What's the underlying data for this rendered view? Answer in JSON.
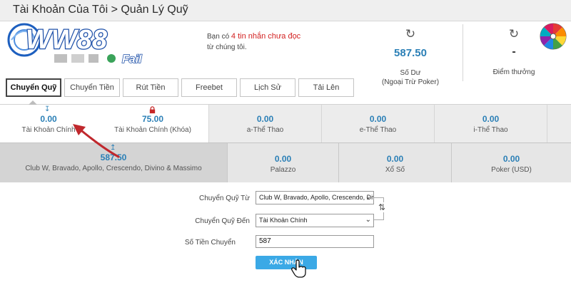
{
  "breadcrumb": "Tài Khoản Của Tôi > Quản Lý Quỹ",
  "logo": {
    "text": "WW88",
    "suffix": "Fail"
  },
  "message": {
    "prefix": "Bạn có",
    "highlight": "4 tin nhắn chưa đọc",
    "suffix": "từ chúng tôi."
  },
  "balance": {
    "value": "587.50",
    "label": "Số Dư",
    "note": "(Ngoại Trừ Poker)"
  },
  "points": {
    "value": "-",
    "label": "Điểm thưởng"
  },
  "icons": {
    "refresh": "refresh-icon",
    "wheel": "lucky-wheel-icon",
    "lock": "lock-icon",
    "arrow": "down-arrow-icon",
    "cursor": "hand-cursor-icon"
  },
  "tabs": [
    {
      "label": "Chuyển Quỹ",
      "active": true
    },
    {
      "label": "Chuyển Tiền"
    },
    {
      "label": "Rút Tiền"
    },
    {
      "label": "Freebet"
    },
    {
      "label": "Lịch Sử"
    },
    {
      "label": "Tải Lên"
    }
  ],
  "wallets_row1": [
    {
      "value": "0.00",
      "label": "Tài Khoản Chính"
    },
    {
      "value": "75.00",
      "label": "Tài Khoản Chính (Khóa)"
    },
    {
      "value": "0.00",
      "label": "a-Thể Thao"
    },
    {
      "value": "0.00",
      "label": "e-Thể Thao"
    },
    {
      "value": "0.00",
      "label": "i-Thể Thao"
    }
  ],
  "wallets_row2": [
    {
      "value": "587.50",
      "label": "Club W, Bravado, Apollo, Crescendo, Divino & Massimo"
    },
    {
      "value": "0.00",
      "label": "Palazzo"
    },
    {
      "value": "0.00",
      "label": "Xổ Số"
    },
    {
      "value": "0.00",
      "label": "Poker (USD)"
    }
  ],
  "form": {
    "from_label": "Chuyển Quỹ Từ",
    "from_value": "Club W, Bravado, Apollo, Crescendo, Divino & Massimo",
    "to_label": "Chuyển Quỹ Đến",
    "to_value": "Tài Khoản Chính",
    "amount_label": "Số Tiền Chuyển",
    "amount_value": "587",
    "submit_label": "XÁC NHẬN"
  },
  "colors": {
    "accent": "#2a7fb6",
    "button": "#3ba9e6",
    "alert": "#d21f1f",
    "annotation": "#c0282d"
  }
}
